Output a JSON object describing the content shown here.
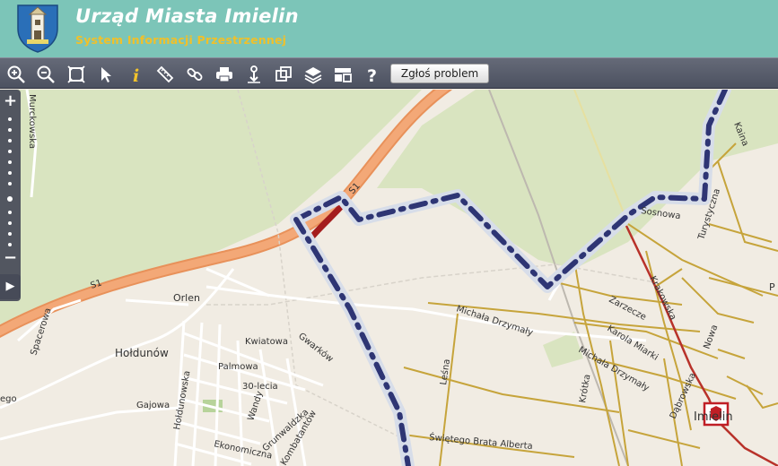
{
  "header": {
    "title": "Urząd Miasta Imielin",
    "subtitle": "System Informacji Przestrzennej"
  },
  "toolbar": {
    "tools": [
      {
        "name": "zoom-in-icon"
      },
      {
        "name": "zoom-out-icon"
      },
      {
        "name": "zoom-extent-icon"
      },
      {
        "name": "pointer-icon"
      },
      {
        "name": "info-icon"
      },
      {
        "name": "measure-icon"
      },
      {
        "name": "link-icon"
      },
      {
        "name": "print-icon"
      },
      {
        "name": "download-icon"
      },
      {
        "name": "overview-icon"
      },
      {
        "name": "layers-icon"
      },
      {
        "name": "layout-icon"
      },
      {
        "name": "help-icon"
      }
    ],
    "report_label": "Zgłoś problem"
  },
  "zoom": {
    "plus_label": "+",
    "minus_label": "−",
    "panel_label": "▶"
  },
  "map": {
    "labels": {
      "murckowska": "Murckowska",
      "s1_a": "S1",
      "s1_b": "S1",
      "orlen": "Orlen",
      "spacerowa": "Spacerowa",
      "holdunow": "Hołdunów",
      "kwiatowa": "Kwiatowa",
      "gwarkow": "Gwarków",
      "palmowa": "Palmowa",
      "lecia": "30-lecia",
      "holdunowska": "Hołdunowska",
      "gajowa": "Gajowa",
      "wandy": "Wandy",
      "grunwaldzka": "Grunwaldzka",
      "ekonomiczna": "Ekonomiczna",
      "kombatantow": "Kombatantów",
      "michala_a": "Michała Drzymały",
      "michala_b": "Michała Drzymały",
      "lesna": "Leśna",
      "swietego": "Świętego Brata Alberta",
      "zawodzie": "Zarzecze",
      "karola": "Karola Miarki",
      "imielin_town": "Imielin",
      "sosnowa": "Sosnowa",
      "turystyczna": "Turystyczna",
      "krakowska": "Krakowska",
      "nowa": "Nowa",
      "p_label": "P",
      "edge_label": "ego",
      "dabrowska": "Dąbrowska",
      "lesna2": "Leśna",
      "krotka": "Krótka",
      "kaina": "Kaina"
    }
  }
}
